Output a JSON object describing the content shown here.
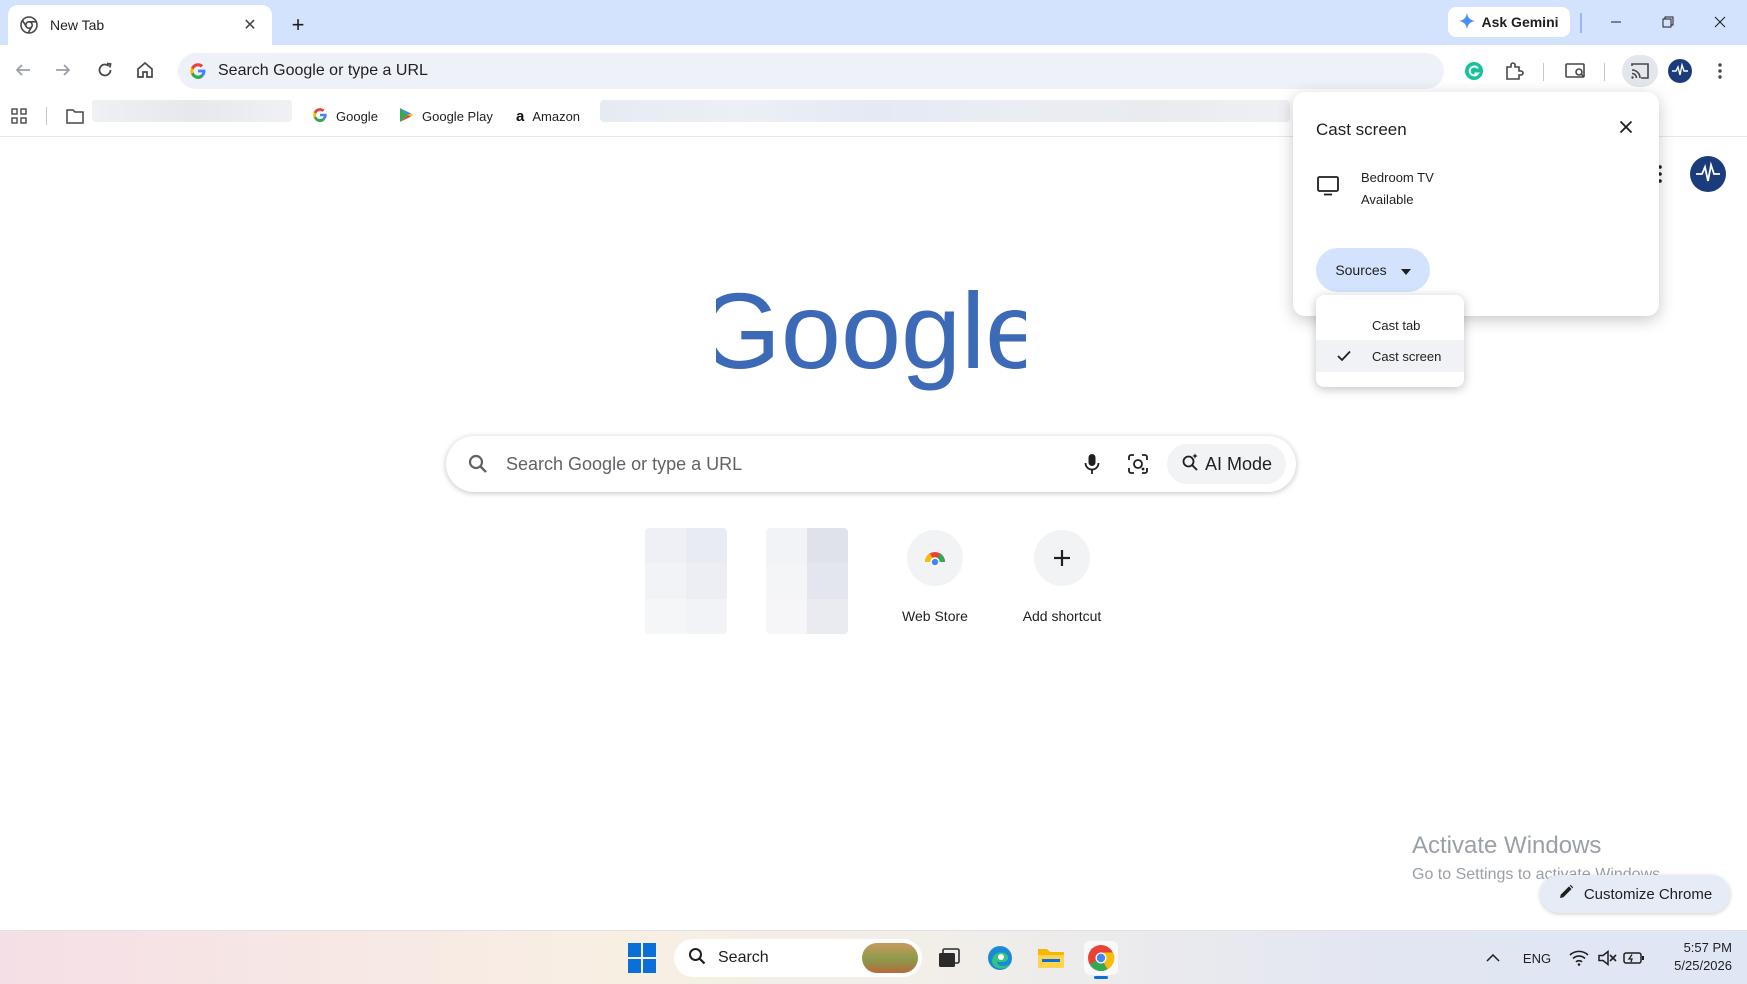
{
  "tab": {
    "title": "New Tab"
  },
  "gemini": {
    "label": "Ask Gemini"
  },
  "omnibox": {
    "text": "Search Google or type a URL"
  },
  "bookmarks": [
    {
      "label": "Google",
      "icon": "google-g-icon"
    },
    {
      "label": "Google Play",
      "icon": "google-play-icon"
    },
    {
      "label": "Amazon",
      "icon": "amazon-icon"
    }
  ],
  "ntp": {
    "logo_text": "Google",
    "search_placeholder": "Search Google or type a URL",
    "ai_mode_label": "AI Mode",
    "shortcuts": [
      {
        "label": "Web Store",
        "icon": "chrome-web-store-icon"
      },
      {
        "label": "Add shortcut",
        "icon": "plus-icon"
      }
    ]
  },
  "cast_popup": {
    "title": "Cast screen",
    "device_name": "Bedroom TV",
    "device_status": "Available",
    "sources_label": "Sources",
    "sources_menu": [
      {
        "label": "Cast tab",
        "selected": false
      },
      {
        "label": "Cast screen",
        "selected": true
      }
    ]
  },
  "watermark": {
    "line1": "Activate Windows",
    "line2": "Go to Settings to activate Windows."
  },
  "customize": {
    "label": "Customize Chrome"
  },
  "taskbar": {
    "search_label": "Search",
    "language": "ENG",
    "time": "5:57 PM",
    "date": "5/25/2026"
  },
  "colors": {
    "tabstrip_bg": "#d3e3fd",
    "omnibox_bg": "#eef1f8",
    "google_logo": "#3c6ab7",
    "sources_button_bg": "#d3e3fd",
    "accent_blue": "#0a6fd8"
  }
}
